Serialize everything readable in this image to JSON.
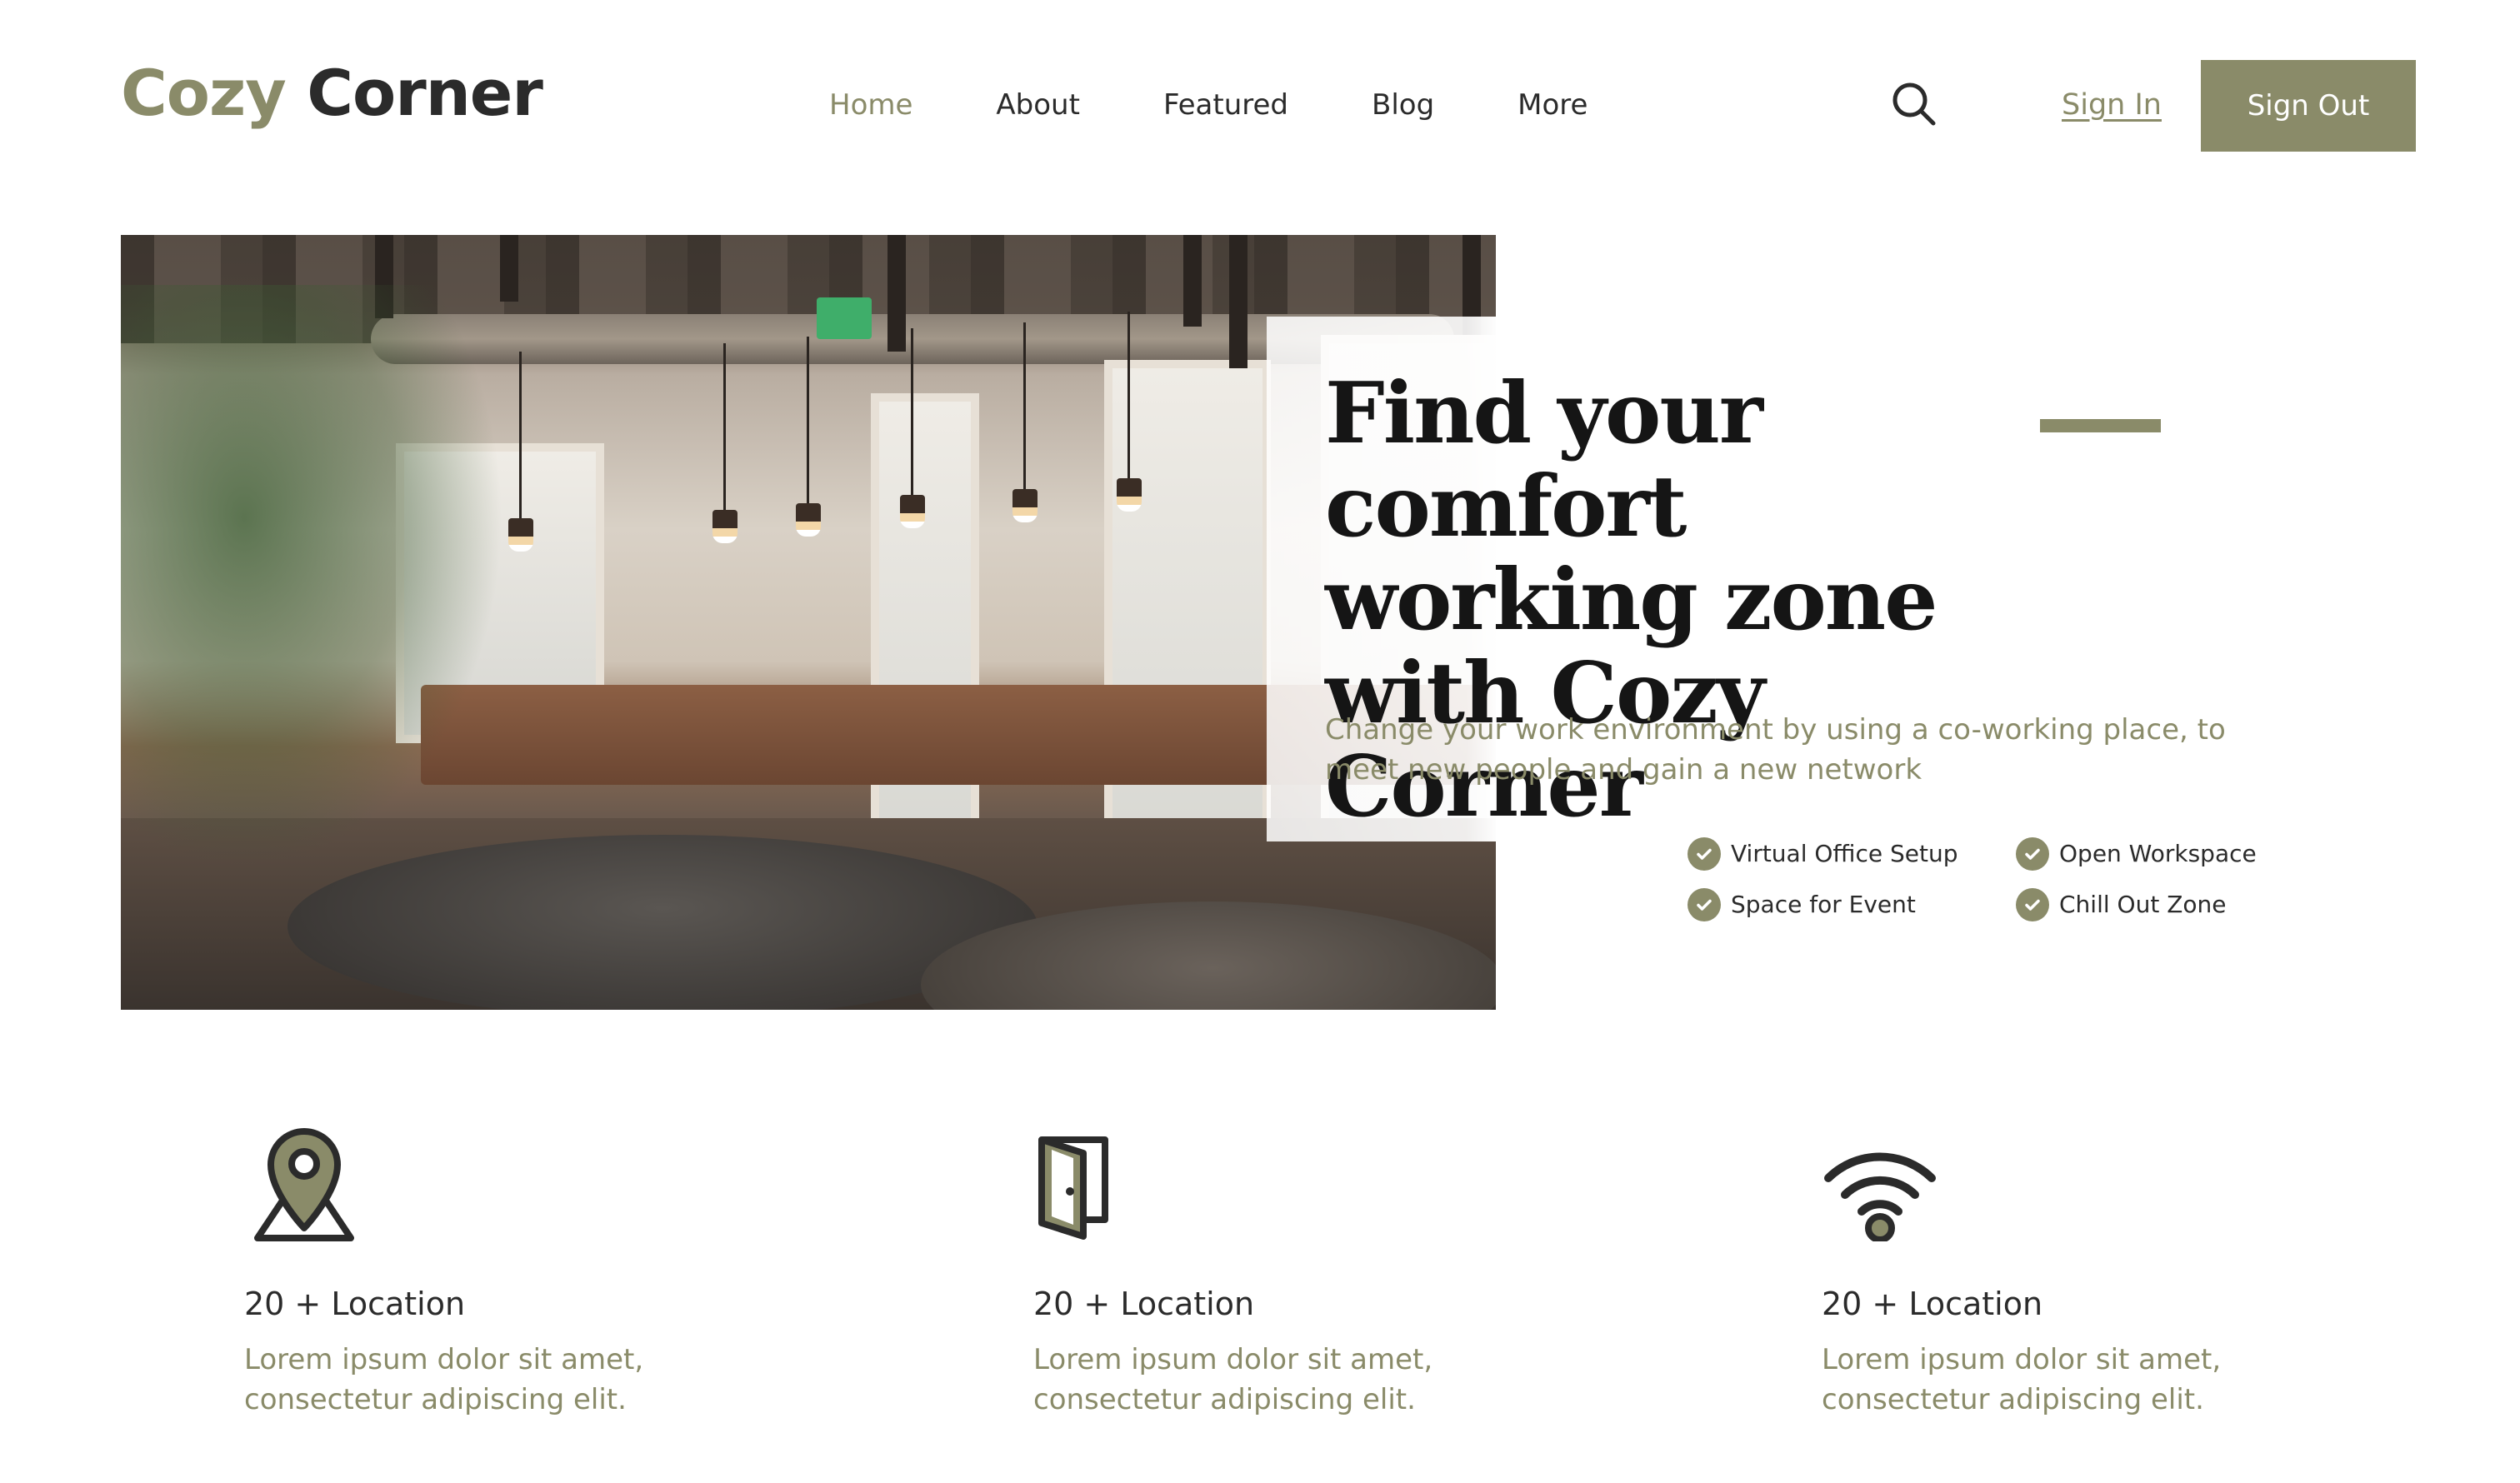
{
  "brand": {
    "part1": "Cozy",
    "part2": "Corner"
  },
  "nav": {
    "items": [
      {
        "label": "Home",
        "active": true
      },
      {
        "label": "About",
        "active": false
      },
      {
        "label": "Featured",
        "active": false
      },
      {
        "label": "Blog",
        "active": false
      },
      {
        "label": "More",
        "active": false
      }
    ]
  },
  "header": {
    "search_icon": "search-icon",
    "sign_in": "Sign In",
    "sign_out": "Sign Out"
  },
  "hero": {
    "title": "Find your comfort working zone with Cozy Corner",
    "subtitle": "Change your work environment by using a co-working place, to meet new people and gain a new network",
    "features": [
      "Virtual Office Setup",
      "Open Workspace",
      "Space for Event",
      "Chill Out Zone"
    ]
  },
  "stats": [
    {
      "icon": "location-pin-icon",
      "title": "20 + Location",
      "description": "Lorem ipsum dolor sit amet, consectetur adipiscing elit."
    },
    {
      "icon": "door-icon",
      "title": "20 + Location",
      "description": "Lorem ipsum dolor sit amet, consectetur adipiscing elit."
    },
    {
      "icon": "wifi-icon",
      "title": "20 + Location",
      "description": "Lorem ipsum dolor sit amet, consectetur adipiscing elit."
    }
  ],
  "colors": {
    "accent": "#8a8b69",
    "text": "#2b2b2b",
    "heading": "#151515",
    "background": "#ffffff"
  }
}
